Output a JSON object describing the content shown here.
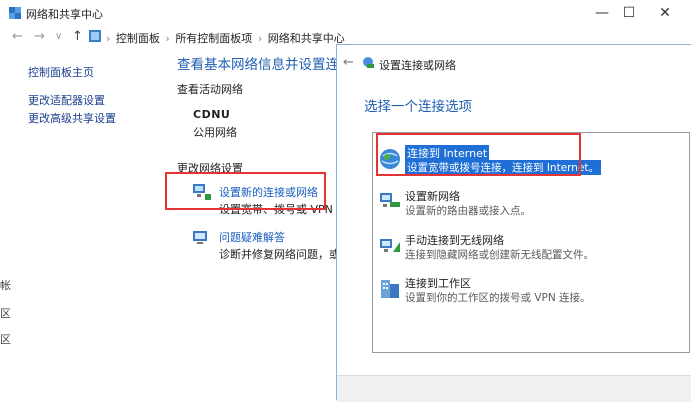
{
  "window": {
    "title": "网络和共享中心",
    "controls": {
      "minimize": "—",
      "maximize": "☐",
      "close": "✕"
    }
  },
  "address": {
    "crumbs": [
      "控制面板",
      "所有控制面板项",
      "网络和共享中心"
    ],
    "separator": "›"
  },
  "sidebar": {
    "items": [
      {
        "label": "控制面板主页"
      },
      {
        "label": "更改适配器设置"
      },
      {
        "label": "更改高级共享设置"
      }
    ]
  },
  "main": {
    "heading": "查看基本网络信息并设置连接",
    "active_networks_label": "查看活动网络",
    "network_name": "CDNU",
    "network_type": "公用网络",
    "change_settings_label": "更改网络设置",
    "actions": [
      {
        "title": "设置新的连接或网络",
        "desc": "设置宽带、拨号或 VPN 连接"
      },
      {
        "title": "问题疑难解答",
        "desc": "诊断并修复网络问题，或者获"
      }
    ]
  },
  "left_edge": {
    "chars": [
      "帐",
      "区",
      "",
      "区"
    ]
  },
  "dialog": {
    "title": "设置连接或网络",
    "heading": "选择一个连接选项",
    "options": [
      {
        "name": "连接到 Internet",
        "desc": "设置宽带或拨号连接，连接到 Internet。",
        "icon": "globe-icon"
      },
      {
        "name": "设置新网络",
        "desc": "设置新的路由器或接入点。",
        "icon": "network-icon"
      },
      {
        "name": "手动连接到无线网络",
        "desc": "连接到隐藏网络或创建新无线配置文件。",
        "icon": "wireless-icon"
      },
      {
        "name": "连接到工作区",
        "desc": "设置到你的工作区的拨号或 VPN 连接。",
        "icon": "workplace-icon"
      }
    ]
  },
  "colors": {
    "accent": "#1f5fb2",
    "highlight": "#1f6fd6",
    "red_frame": "#e53434"
  }
}
